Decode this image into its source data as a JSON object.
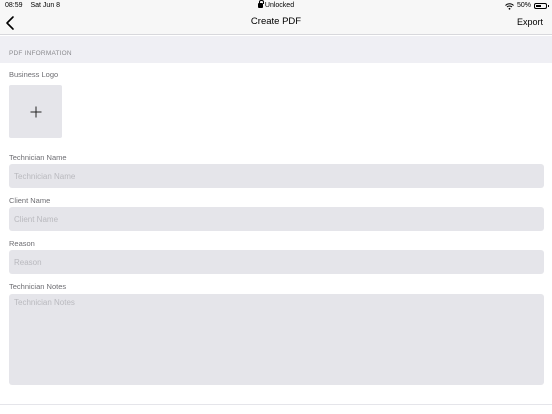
{
  "status_bar": {
    "time": "08:59",
    "date": "Sat Jun 8",
    "center": "Unlocked",
    "battery": "50%",
    "battery_level": 0.5
  },
  "nav": {
    "title": "Create PDF",
    "export_label": "Export"
  },
  "section": {
    "header": "PDF INFORMATION"
  },
  "form": {
    "logo_label": "Business Logo",
    "technician_label": "Technician Name",
    "technician_placeholder": "Technician Name",
    "client_label": "Client Name",
    "client_placeholder": "Client Name",
    "reason_label": "Reason",
    "reason_placeholder": "Reason",
    "notes_label": "Technician Notes",
    "notes_placeholder": "Technician Notes"
  }
}
